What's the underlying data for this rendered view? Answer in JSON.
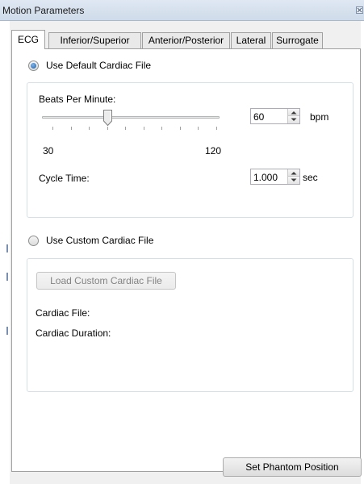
{
  "window": {
    "title": "Motion Parameters"
  },
  "tabs": [
    {
      "label": "ECG",
      "active": true
    },
    {
      "label": "Inferior/Superior",
      "active": false
    },
    {
      "label": "Anterior/Posterior",
      "active": false
    },
    {
      "label": "Lateral",
      "active": false
    },
    {
      "label": "Surrogate",
      "active": false
    }
  ],
  "default_cardiac": {
    "radio_label": "Use Default Cardiac File",
    "selected": true,
    "bpm_label": "Beats Per Minute:",
    "slider": {
      "min": 30,
      "max": 120,
      "value": 60,
      "min_label": "30",
      "max_label": "120"
    },
    "bpm_value": "60",
    "bpm_unit": "bpm",
    "cycle_label": "Cycle Time:",
    "cycle_value": "1.000",
    "cycle_unit": "sec"
  },
  "custom_cardiac": {
    "radio_label": "Use Custom Cardiac File",
    "selected": false,
    "load_button": "Load Custom Cardiac File",
    "file_label": "Cardiac File:",
    "duration_label": "Cardiac Duration:"
  },
  "footer": {
    "set_phantom_button": "Set Phantom Position"
  },
  "icons": {
    "close": "close-icon",
    "spin_up": "spin-up-arrow-icon",
    "spin_down": "spin-down-arrow-icon"
  }
}
